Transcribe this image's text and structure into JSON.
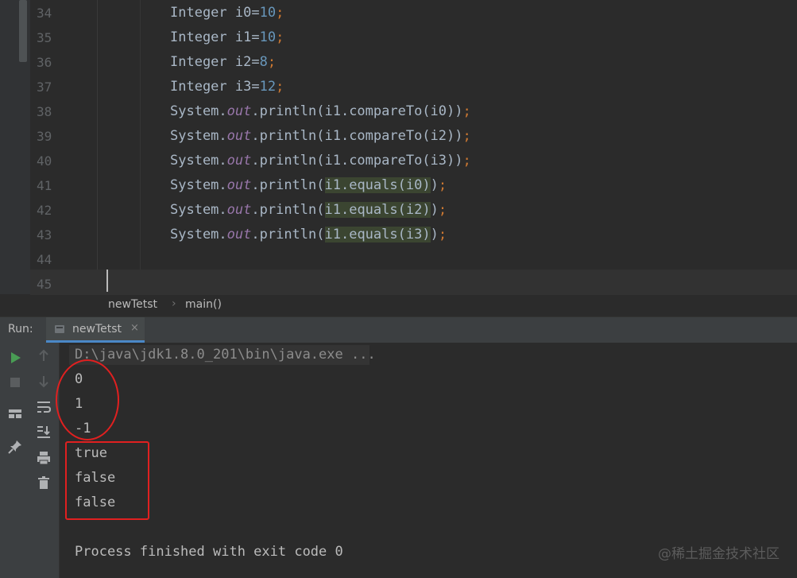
{
  "editor": {
    "lines": [
      {
        "n": "34"
      },
      {
        "n": "35"
      },
      {
        "n": "36"
      },
      {
        "n": "37"
      },
      {
        "n": "38"
      },
      {
        "n": "39"
      },
      {
        "n": "40"
      },
      {
        "n": "41"
      },
      {
        "n": "42"
      },
      {
        "n": "43"
      },
      {
        "n": "44"
      },
      {
        "n": "45"
      }
    ],
    "code": {
      "l34": {
        "a": "Integer i0=",
        "b": "10",
        "c": ";"
      },
      "l35": {
        "a": "Integer i1=",
        "b": "10",
        "c": ";"
      },
      "l36": {
        "a": "Integer i2=",
        "b": "8",
        "c": ";"
      },
      "l37": {
        "a": "Integer i3=",
        "b": "12",
        "c": ";"
      },
      "l38": {
        "a": "System.",
        "f": "out",
        "b": ".println(i1.compareTo(i0))",
        "c": ";"
      },
      "l39": {
        "a": "System.",
        "f": "out",
        "b": ".println(i1.compareTo(i2))",
        "c": ";"
      },
      "l40": {
        "a": "System.",
        "f": "out",
        "b": ".println(i1.compareTo(i3))",
        "c": ";"
      },
      "l41": {
        "a": "System.",
        "f": "out",
        "b": ".println(",
        "h": "i1.equals(i0)",
        "d": ")",
        "c": ";"
      },
      "l42": {
        "a": "System.",
        "f": "out",
        "b": ".println(",
        "h": "i1.equals(i2)",
        "d": ")",
        "c": ";"
      },
      "l43": {
        "a": "System.",
        "f": "out",
        "b": ".println(",
        "h": "i1.equals(i3)",
        "d": ")",
        "c": ";"
      }
    }
  },
  "breadcrumb": {
    "file": "newTetst",
    "sep": "›",
    "method": "main()"
  },
  "run": {
    "label": "Run:",
    "tab": "newTetst",
    "close": "×",
    "command": "D:\\java\\jdk1.8.0_201\\bin\\java.exe ...",
    "output": [
      "0",
      "1",
      "-1",
      "true",
      "false",
      "false"
    ],
    "finished": "Process finished with exit code 0"
  },
  "watermark": "@稀土掘金技术社区",
  "icons": {
    "run": "play-icon",
    "stop": "stop-icon",
    "layout": "layout-icon",
    "pin": "pin-icon",
    "up": "arrow-up-icon",
    "down": "arrow-down-icon",
    "wrap": "soft-wrap-icon",
    "scroll": "scroll-to-end-icon",
    "print": "print-icon",
    "trash": "trash-icon"
  },
  "colors": {
    "accent": "#e02020",
    "play": "#499c54",
    "keyword_number": "#6897bb",
    "field": "#9876aa",
    "semicolon": "#cc7832"
  }
}
